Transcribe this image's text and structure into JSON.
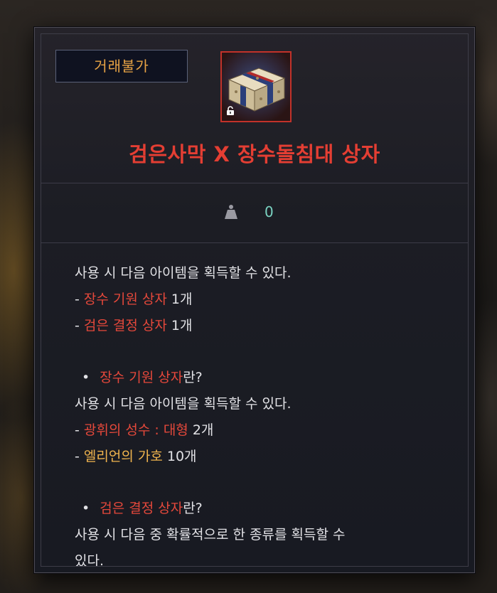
{
  "tooltip": {
    "badge_label": "거래불가",
    "item_name": "검은사막 X 장수돌침대 상자",
    "weight_value": "0",
    "icons": {
      "item": "treasure-chest-icon",
      "lock": "lock-open-icon",
      "weight": "weight-icon"
    },
    "colors": {
      "title": "#e43e33",
      "badge_text": "#e8a445",
      "highlight_red": "#e5483b",
      "highlight_gold": "#f0b44e",
      "weight_value": "#7ad3c1"
    }
  },
  "description": {
    "intro": "사용 시 다음 아이템을 획득할 수 있다.",
    "items": [
      {
        "prefix": "- ",
        "name": "장수 기원 상자",
        "qty": "1개"
      },
      {
        "prefix": "- ",
        "name": "검은 결정 상자",
        "qty": "1개"
      }
    ],
    "section1": {
      "bullet": "•",
      "name": "장수 기원 상자",
      "suffix": "란?",
      "intro": "사용 시 다음 아이템을 획득할 수 있다.",
      "items": [
        {
          "prefix": "- ",
          "name": "광휘의 성수 : 대형",
          "qty": " 2개"
        },
        {
          "prefix": "- ",
          "name": "엘리언의 가호",
          "qty": " 10개"
        }
      ]
    },
    "section2": {
      "bullet": "•",
      "name": "검은 결정 상자",
      "suffix": "란?",
      "intro": "사용 시 다음 중 확률적으로 한 종류를 획득할 수",
      "cut_line": "있다."
    }
  }
}
